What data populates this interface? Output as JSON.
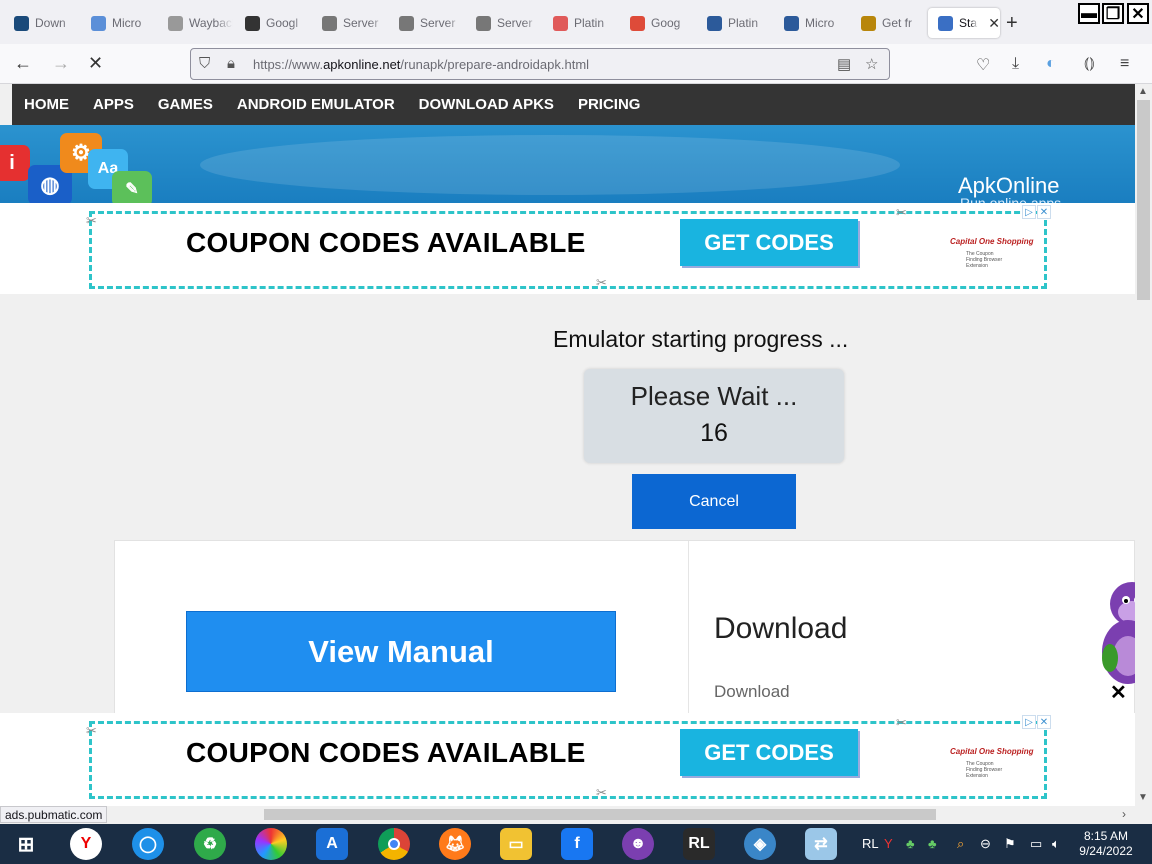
{
  "browser": {
    "tabs": [
      {
        "label": "Down",
        "icon": "download-page-icon",
        "color": "#1a4a7a"
      },
      {
        "label": "Micro",
        "icon": "shield-favicon-icon",
        "color": "#5b8fd8"
      },
      {
        "label": "Wayback",
        "icon": "wayback-icon",
        "color": "#999999"
      },
      {
        "label": "Googl",
        "icon": "google-dots-icon",
        "color": "#333333"
      },
      {
        "label": "Server",
        "icon": "info-icon",
        "color": "#777777"
      },
      {
        "label": "Server",
        "icon": "info-icon",
        "color": "#777777"
      },
      {
        "label": "Server",
        "icon": "info-icon",
        "color": "#777777"
      },
      {
        "label": "Platin",
        "icon": "rainbow-icon",
        "color": "#e05a5a"
      },
      {
        "label": "Goog",
        "icon": "chrome-icon",
        "color": "#de4b39"
      },
      {
        "label": "Platin",
        "icon": "square-favicon-icon",
        "color": "#2c5a9a"
      },
      {
        "label": "Micro",
        "icon": "square-favicon-icon",
        "color": "#2c5a9a"
      },
      {
        "label": "Get fr",
        "icon": "bag-icon",
        "color": "#b8860b"
      },
      {
        "label": "Star",
        "icon": "globe-icon",
        "color": "#3a6fc4",
        "active": true
      }
    ],
    "url_prefix": "https://www.",
    "url_domain": "apkonline.net",
    "url_path": "/runapk/prepare-androidapk.html",
    "status_url": "ads.pubmatic.com"
  },
  "site": {
    "nav": [
      "HOME",
      "APPS",
      "GAMES",
      "ANDROID EMULATOR",
      "DOWNLOAD APKS",
      "PRICING"
    ],
    "brand": "ApkOnline",
    "brand_sub": "Run online apps"
  },
  "ad": {
    "headline": "COUPON CODES AVAILABLE",
    "cta": "GET CODES",
    "sponsor": "Capital One Shopping",
    "sponsor_sub": "The Coupon Finding Browser Extension"
  },
  "emulator": {
    "title": "Emulator starting progress ...",
    "wait_text": "Please Wait ...",
    "countdown": "16",
    "cancel_label": "Cancel"
  },
  "lower": {
    "view_manual": "View Manual",
    "download_heading": "Download",
    "download_link": "Download"
  },
  "taskbar": {
    "time": "8:15 AM",
    "date": "9/24/2022"
  }
}
